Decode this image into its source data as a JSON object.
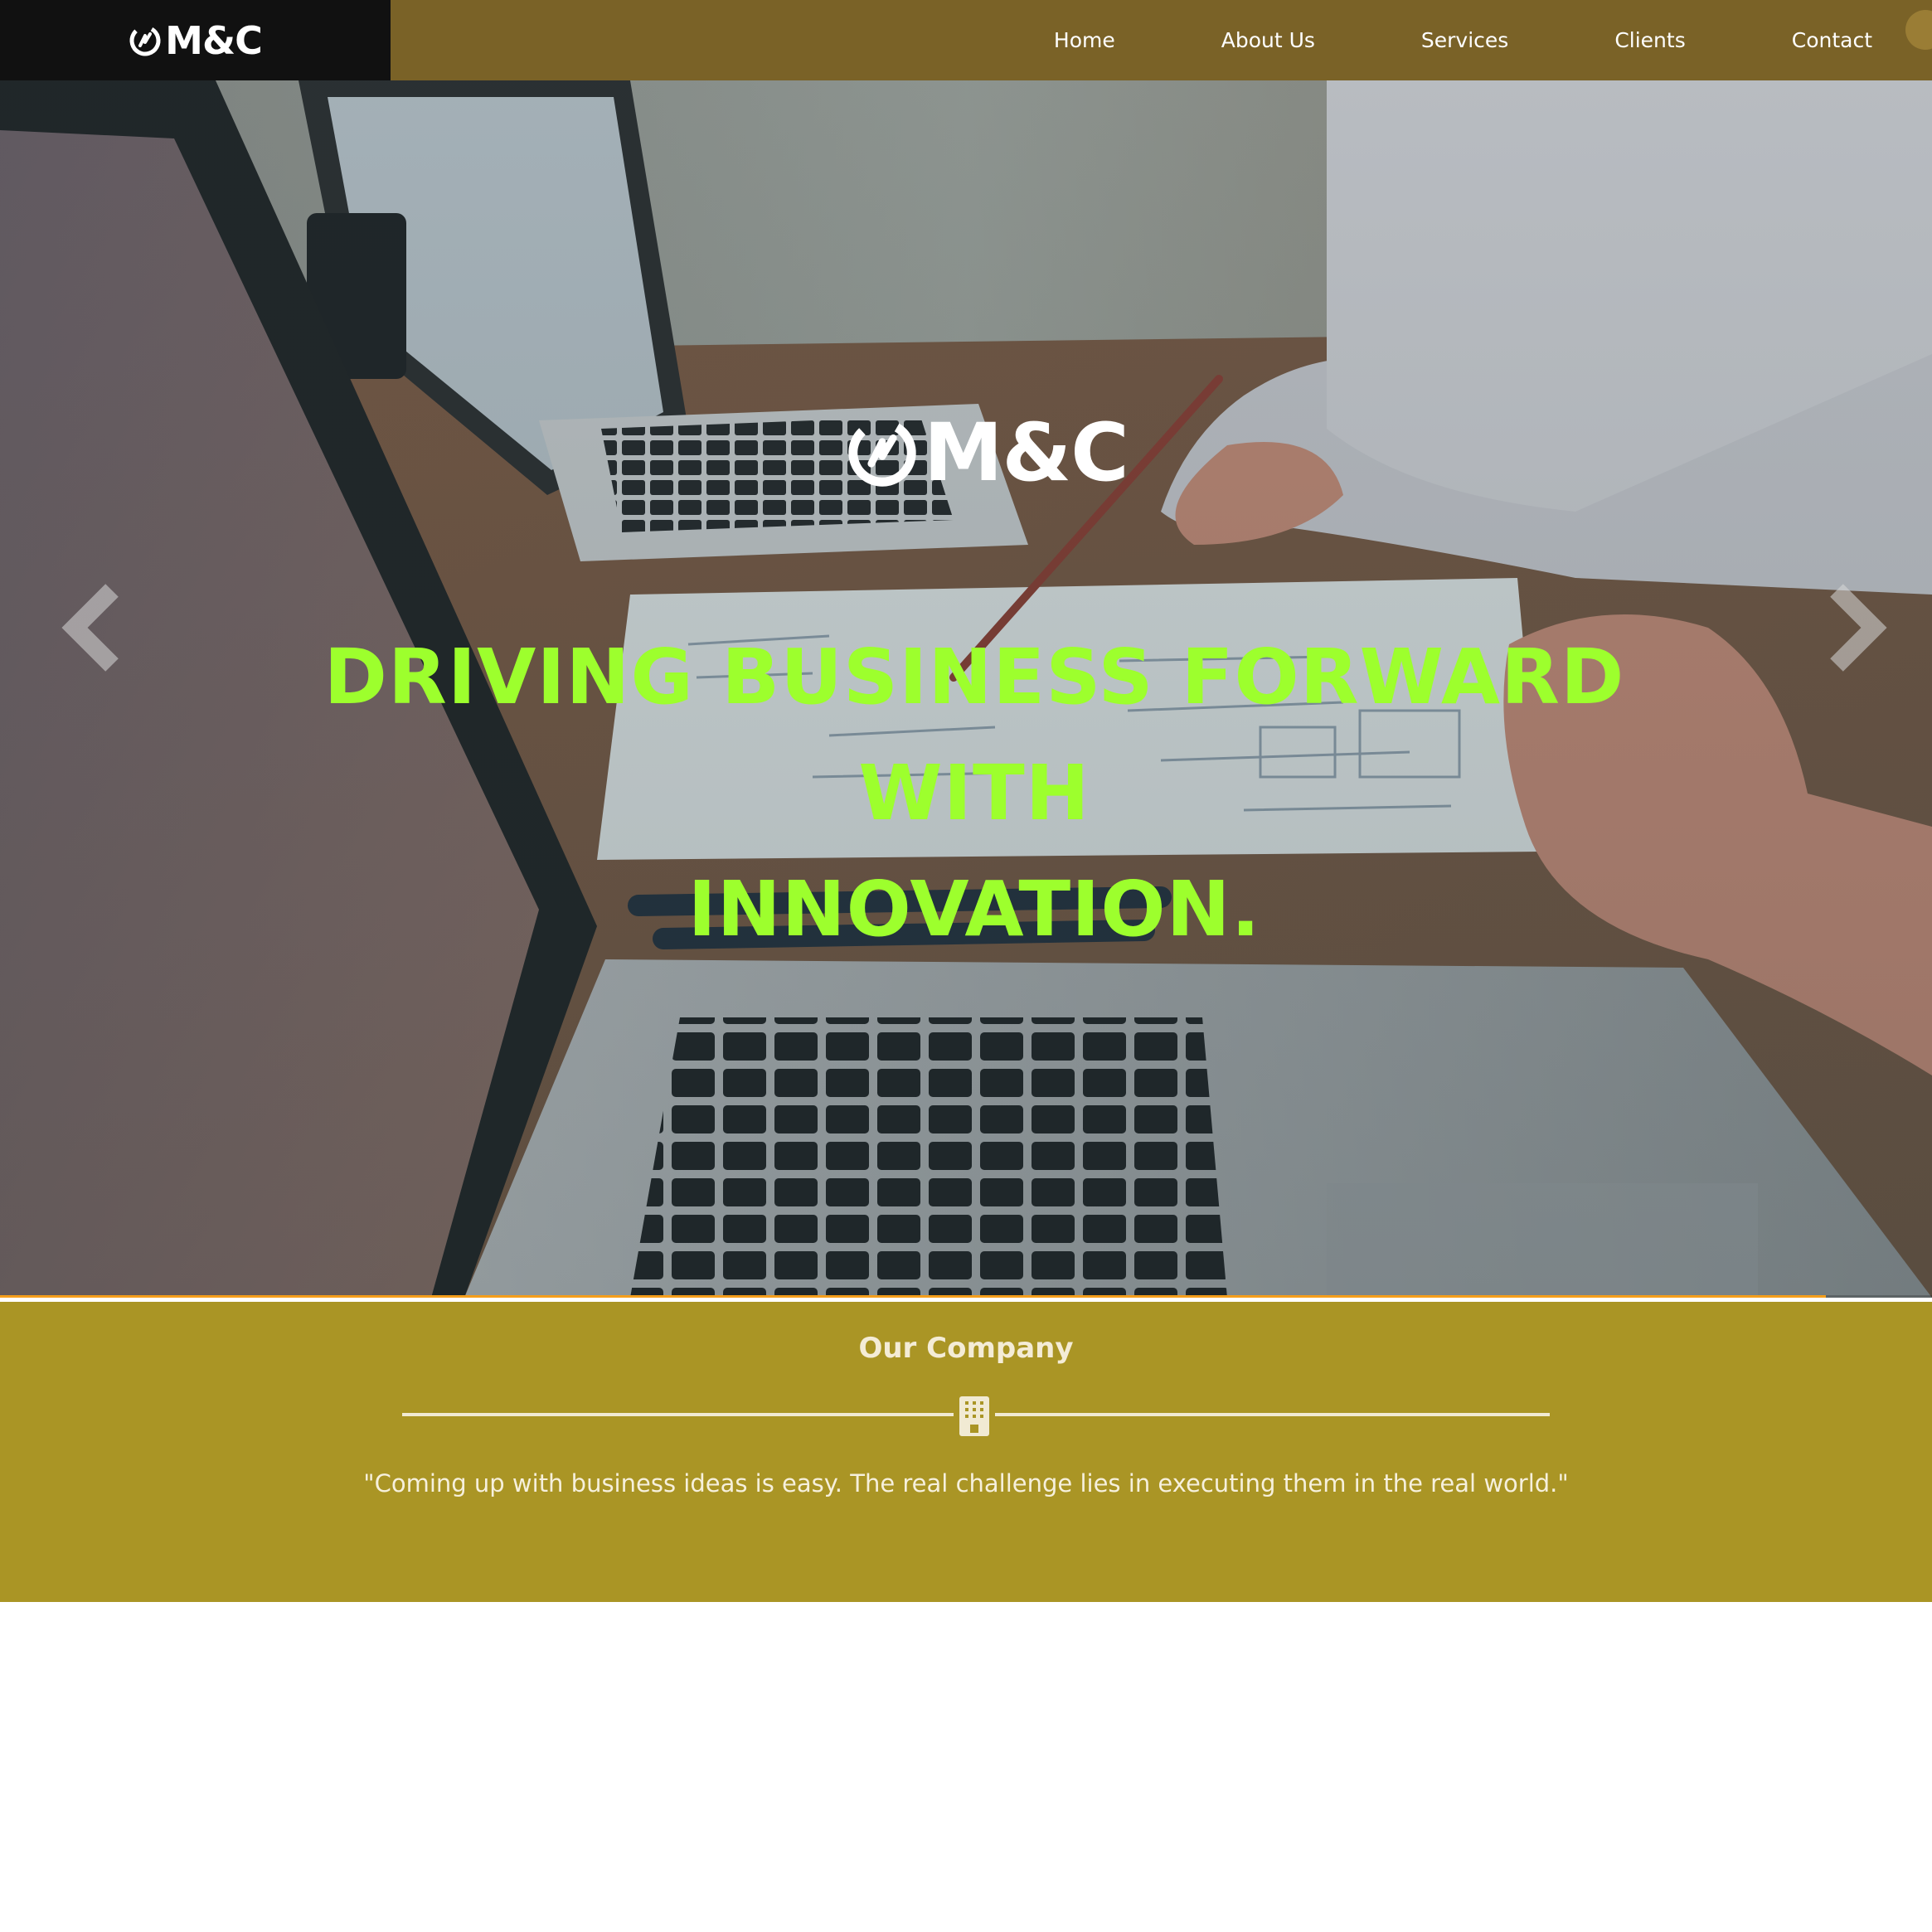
{
  "brand": {
    "name": "M&C"
  },
  "nav": {
    "items": [
      {
        "label": "Home"
      },
      {
        "label": "About Us"
      },
      {
        "label": "Services"
      },
      {
        "label": "Clients"
      },
      {
        "label": "Contact"
      }
    ]
  },
  "hero": {
    "logo_text": "M&C",
    "headline_line1": "DRIVING BUSINESS FORWARD WITH",
    "headline_line2": "INNOVATION.",
    "prev_icon": "chevron-left-icon",
    "next_icon": "chevron-right-icon",
    "slide_progress_percent": 94.5
  },
  "company": {
    "title": "Our Company",
    "divider_icon": "building-icon",
    "quote": "\"Coming up with business ideas is easy. The real challenge lies in executing them in the real world.\""
  },
  "colors": {
    "navbar": "#7a6227",
    "brand_box": "#111111",
    "headline": "#9dff2d",
    "progress": "#f59e1b",
    "company_bg": "#aa9525",
    "company_text": "#f4ecd6"
  }
}
